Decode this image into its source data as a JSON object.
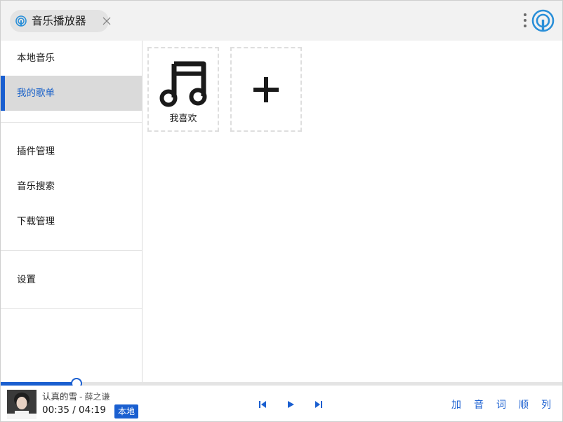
{
  "titlebar": {
    "tab_label": "音乐播放器"
  },
  "sidebar": {
    "items": [
      {
        "label": "本地音乐"
      },
      {
        "label": "我的歌单",
        "active": true
      },
      {
        "label": "插件管理"
      },
      {
        "label": "音乐搜索"
      },
      {
        "label": "下载管理"
      },
      {
        "label": "设置"
      }
    ]
  },
  "main": {
    "cards": [
      {
        "label": "我喜欢",
        "icon": "music-note-icon"
      },
      {
        "label": "",
        "icon": "plus-icon"
      }
    ]
  },
  "player": {
    "song_title": "认真的雪",
    "separator": "-",
    "artist": "薛之谦",
    "time": "00:35 / 04:19",
    "badge": "本地",
    "progress": 0.135,
    "right_buttons": [
      "加",
      "音",
      "词",
      "顺",
      "列"
    ]
  },
  "colors": {
    "accent": "#1a5fd0",
    "titlebar_bg": "#f2f2f2",
    "active_bg": "#dadada"
  }
}
